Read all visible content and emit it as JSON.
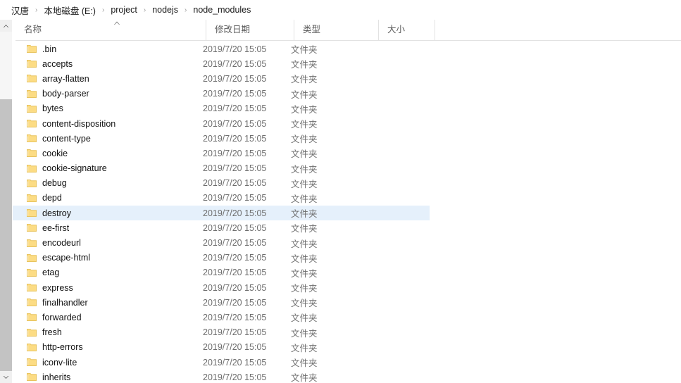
{
  "breadcrumb": {
    "separator": "›",
    "items": [
      {
        "label": "汉唐"
      },
      {
        "label": "本地磁盘 (E:)"
      },
      {
        "label": "project"
      },
      {
        "label": "nodejs"
      },
      {
        "label": "node_modules"
      }
    ]
  },
  "columns": {
    "name": "名称",
    "date_modified": "修改日期",
    "type": "类型",
    "size": "大小"
  },
  "sort": {
    "column": "名称",
    "direction": "ascending",
    "icon": "sort-ascending-caret-icon"
  },
  "scrollbar": {
    "up_icon": "chevron-up-icon",
    "down_icon": "chevron-down-icon",
    "orientation": "vertical"
  },
  "colors": {
    "selection": "#e5f0fb",
    "folder_fill": "#fcdc84",
    "folder_stroke": "#e8c45f",
    "header_text": "#5b5b5b",
    "secondary_text": "#6d6d6d",
    "scrollbar_track": "#c3c3c3",
    "scrollbar_thumb": "#f6f6f6"
  },
  "rows": [
    {
      "name": ".bin",
      "date": "2019/7/20 15:05",
      "type": "文件夹",
      "size": "",
      "selected": false,
      "icon": "folder-icon"
    },
    {
      "name": "accepts",
      "date": "2019/7/20 15:05",
      "type": "文件夹",
      "size": "",
      "selected": false,
      "icon": "folder-icon"
    },
    {
      "name": "array-flatten",
      "date": "2019/7/20 15:05",
      "type": "文件夹",
      "size": "",
      "selected": false,
      "icon": "folder-icon"
    },
    {
      "name": "body-parser",
      "date": "2019/7/20 15:05",
      "type": "文件夹",
      "size": "",
      "selected": false,
      "icon": "folder-icon"
    },
    {
      "name": "bytes",
      "date": "2019/7/20 15:05",
      "type": "文件夹",
      "size": "",
      "selected": false,
      "icon": "folder-icon"
    },
    {
      "name": "content-disposition",
      "date": "2019/7/20 15:05",
      "type": "文件夹",
      "size": "",
      "selected": false,
      "icon": "folder-icon"
    },
    {
      "name": "content-type",
      "date": "2019/7/20 15:05",
      "type": "文件夹",
      "size": "",
      "selected": false,
      "icon": "folder-icon"
    },
    {
      "name": "cookie",
      "date": "2019/7/20 15:05",
      "type": "文件夹",
      "size": "",
      "selected": false,
      "icon": "folder-icon"
    },
    {
      "name": "cookie-signature",
      "date": "2019/7/20 15:05",
      "type": "文件夹",
      "size": "",
      "selected": false,
      "icon": "folder-icon"
    },
    {
      "name": "debug",
      "date": "2019/7/20 15:05",
      "type": "文件夹",
      "size": "",
      "selected": false,
      "icon": "folder-icon"
    },
    {
      "name": "depd",
      "date": "2019/7/20 15:05",
      "type": "文件夹",
      "size": "",
      "selected": false,
      "icon": "folder-icon"
    },
    {
      "name": "destroy",
      "date": "2019/7/20 15:05",
      "type": "文件夹",
      "size": "",
      "selected": true,
      "icon": "folder-icon"
    },
    {
      "name": "ee-first",
      "date": "2019/7/20 15:05",
      "type": "文件夹",
      "size": "",
      "selected": false,
      "icon": "folder-icon"
    },
    {
      "name": "encodeurl",
      "date": "2019/7/20 15:05",
      "type": "文件夹",
      "size": "",
      "selected": false,
      "icon": "folder-icon"
    },
    {
      "name": "escape-html",
      "date": "2019/7/20 15:05",
      "type": "文件夹",
      "size": "",
      "selected": false,
      "icon": "folder-icon"
    },
    {
      "name": "etag",
      "date": "2019/7/20 15:05",
      "type": "文件夹",
      "size": "",
      "selected": false,
      "icon": "folder-icon"
    },
    {
      "name": "express",
      "date": "2019/7/20 15:05",
      "type": "文件夹",
      "size": "",
      "selected": false,
      "icon": "folder-icon"
    },
    {
      "name": "finalhandler",
      "date": "2019/7/20 15:05",
      "type": "文件夹",
      "size": "",
      "selected": false,
      "icon": "folder-icon"
    },
    {
      "name": "forwarded",
      "date": "2019/7/20 15:05",
      "type": "文件夹",
      "size": "",
      "selected": false,
      "icon": "folder-icon"
    },
    {
      "name": "fresh",
      "date": "2019/7/20 15:05",
      "type": "文件夹",
      "size": "",
      "selected": false,
      "icon": "folder-icon"
    },
    {
      "name": "http-errors",
      "date": "2019/7/20 15:05",
      "type": "文件夹",
      "size": "",
      "selected": false,
      "icon": "folder-icon"
    },
    {
      "name": "iconv-lite",
      "date": "2019/7/20 15:05",
      "type": "文件夹",
      "size": "",
      "selected": false,
      "icon": "folder-icon"
    },
    {
      "name": "inherits",
      "date": "2019/7/20 15:05",
      "type": "文件夹",
      "size": "",
      "selected": false,
      "icon": "folder-icon"
    }
  ]
}
